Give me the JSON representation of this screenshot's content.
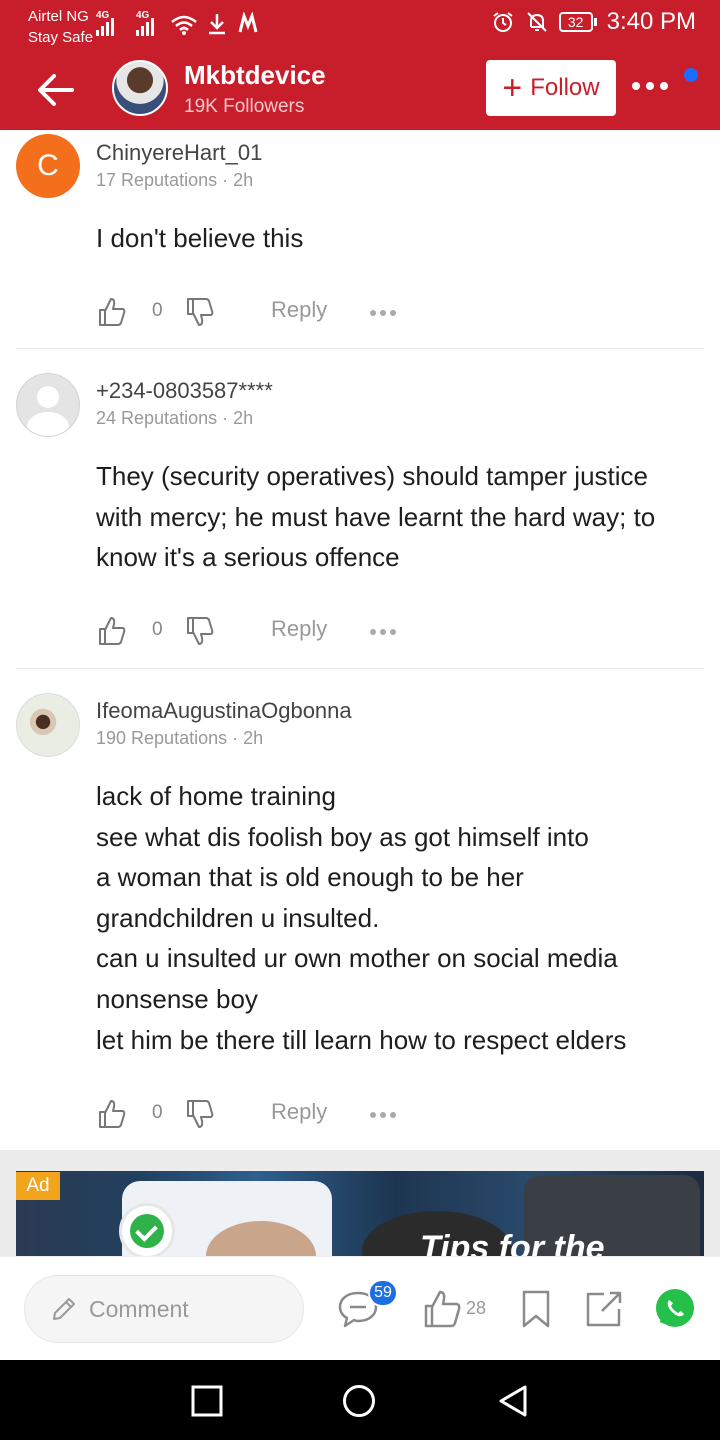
{
  "status_bar": {
    "carrier": "Airtel NG",
    "carrier_sub": "Stay Safe",
    "network_1": "4G",
    "network_2": "4G",
    "battery": "32",
    "time": "3:40 PM"
  },
  "header": {
    "channel_name": "Mkbtdevice",
    "followers": "19K Followers",
    "follow_label": "Follow",
    "background": "#c81e2b"
  },
  "comments": [
    {
      "avatar_letter": "C",
      "name": "ChinyereHart_01",
      "meta": "17 Reputations · 2h",
      "text": "I don't believe this",
      "likes": "0",
      "reply_label": "Reply"
    },
    {
      "avatar_letter": "",
      "name": "+234-0803587****",
      "meta": "24 Reputations · 2h",
      "text": "They (security operatives) should tamper justice\nwith mercy; he must have learnt the hard way; to\nknow it's a serious offence",
      "likes": "0",
      "reply_label": "Reply"
    },
    {
      "avatar_letter": "",
      "name": "IfeomaAugustinaOgbonna",
      "meta": "190 Reputations · 2h",
      "text": "lack of home training\nsee what dis foolish boy as got himself into\na woman that is old enough to be her\ngrandchildren u insulted.\ncan u insulted ur own mother on social media\nnonsense boy\nlet him be there till learn how to respect elders",
      "likes": "0",
      "reply_label": "Reply"
    }
  ],
  "ad": {
    "badge": "Ad",
    "headline": "Tips for the"
  },
  "bottom_bar": {
    "comment_placeholder": "Comment",
    "comment_count": "59",
    "like_count": "28"
  },
  "colors": {
    "brand_red": "#c81e2b",
    "avatar_orange": "#f36f1c",
    "badge_blue": "#1b6fe3",
    "whatsapp_green": "#25c04a",
    "ad_orange": "#f2a41d"
  },
  "icons": [
    "back-arrow-icon",
    "plus-icon",
    "more-icon",
    "thumbs-up-icon",
    "thumbs-down-icon",
    "comment-bubble-icon",
    "bookmark-icon",
    "share-icon",
    "whatsapp-icon",
    "pencil-icon",
    "alarm-icon",
    "mute-icon",
    "wifi-icon",
    "download-icon"
  ]
}
